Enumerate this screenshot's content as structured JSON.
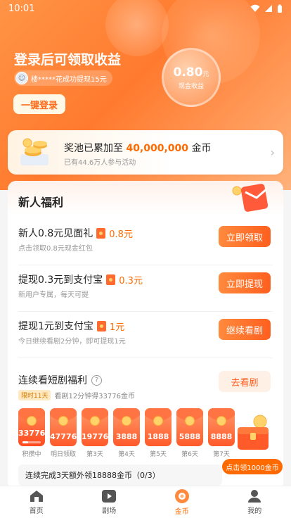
{
  "status_bar": {
    "time": "10:01"
  },
  "hero": {
    "title": "登录后可领取收益",
    "ticker_text": "楼*****花成功提现15元",
    "login_button": "一键登录",
    "coin_amount": "0.80",
    "coin_unit": "元",
    "coin_label": "现金收益"
  },
  "pool": {
    "title_prefix": "奖池已累加至",
    "title_amount": "40,000,000",
    "title_suffix": "金币",
    "subtitle": "已有44.6万人参与活动"
  },
  "newbie": {
    "title": "新人福利",
    "tasks": [
      {
        "title": "新人0.8元见面礼",
        "reward": "0.8元",
        "subtitle": "点击领取0.8元现金红包",
        "button": "立即领取"
      },
      {
        "title": "提现0.3元到支付宝",
        "reward": "0.3元",
        "subtitle": "新用户专属，每天可提",
        "button": "立即提现"
      },
      {
        "title": "提现1元到支付宝",
        "reward": "1元",
        "subtitle": "今日继续看剧2分钟，即可提现1元",
        "button": "继续看剧"
      }
    ]
  },
  "streak": {
    "title": "连续看短剧福利",
    "help_icon": "?",
    "limit_badge": "限时11天",
    "subtitle": "看剧12分钟得33776金币",
    "button": "去看剧",
    "progress": 0.3,
    "days": [
      {
        "value": "33776",
        "label": "积攒中"
      },
      {
        "value": "47776",
        "label": "明日领取"
      },
      {
        "value": "19776",
        "label": "第3天"
      },
      {
        "value": "3888",
        "label": "第4天"
      },
      {
        "value": "1888",
        "label": "第5天"
      },
      {
        "value": "5888",
        "label": "第6天"
      },
      {
        "value": "8888",
        "label": "第7天"
      }
    ],
    "bonus_text": "连续完成3天额外领18888金币（0/3）",
    "chest_button": "点击领1000金币"
  },
  "tabbar": {
    "items": [
      {
        "label": "首页",
        "icon": "home-icon"
      },
      {
        "label": "剧场",
        "icon": "play-icon"
      },
      {
        "label": "金币",
        "icon": "coin-icon"
      },
      {
        "label": "我的",
        "icon": "user-icon"
      }
    ],
    "active_index": 2
  },
  "colors": {
    "accent": "#ff6a00",
    "hero": "#ff8a3d"
  }
}
